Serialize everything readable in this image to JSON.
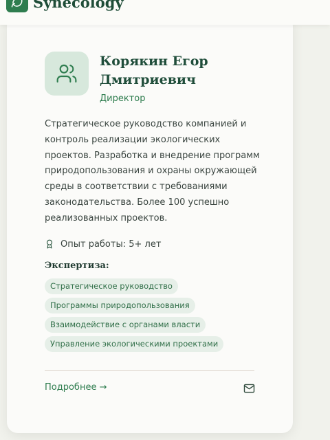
{
  "header": {
    "brand": "Synecology",
    "logo_icon": "leaf-icon"
  },
  "profile": {
    "avatar_icon": "users-icon",
    "name": "Корякин Егор Дмитриевич",
    "role": "Директор",
    "description": "Стратегическое руководство компанией и контроль реализации экологических проектов. Разработка и внедрение программ природопользования и охраны окружающей среды в соответствии с требованиями законодательства. Более 100 успешно реализованных проектов.",
    "experience_icon": "award-icon",
    "experience": "Опыт работы: 5+ лет",
    "expertise_title": "Экспертиза:",
    "expertise": [
      "Стратегическое руководство",
      "Программы природопользования",
      "Взаимодействие с органами власти",
      "Управление экологическими проектами"
    ],
    "more_link": "Подробнее →",
    "mail_icon": "mail-icon"
  },
  "colors": {
    "accent": "#2f7d4f",
    "title": "#1f4d3a",
    "tag_bg": "#e6efe8",
    "avatar_bg": "#d7e8dc"
  }
}
